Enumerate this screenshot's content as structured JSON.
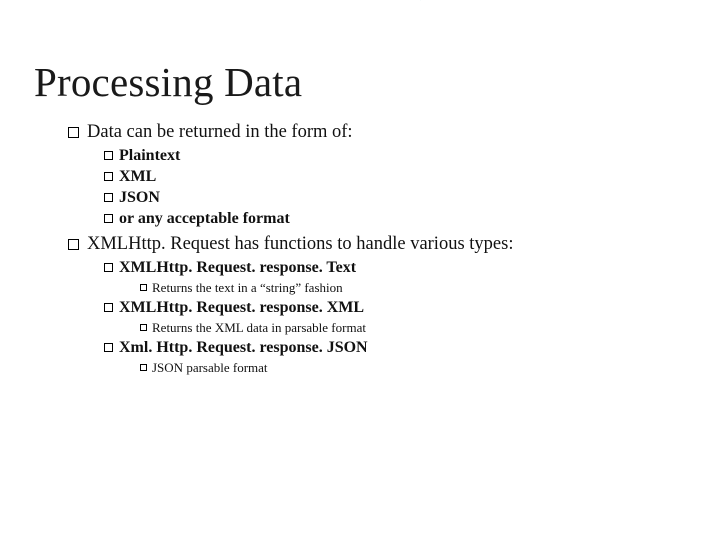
{
  "title": "Processing Data",
  "points": [
    {
      "text": "Data can be returned in the form of:",
      "sub": [
        {
          "text": "Plaintext"
        },
        {
          "text": "XML"
        },
        {
          "text": "JSON"
        },
        {
          "text": "or any acceptable format"
        }
      ]
    },
    {
      "text": "XMLHttp. Request has functions to handle various types:",
      "sub": [
        {
          "text": "XMLHttp. Request. response. Text",
          "sub": [
            {
              "text": "Returns the text in a “string” fashion"
            }
          ]
        },
        {
          "text": "XMLHttp. Request. response. XML",
          "sub": [
            {
              "text": "Returns the XML data in parsable format"
            }
          ]
        },
        {
          "text": "Xml. Http. Request. response. JSON",
          "sub": [
            {
              "text": "JSON parsable format"
            }
          ]
        }
      ]
    }
  ]
}
